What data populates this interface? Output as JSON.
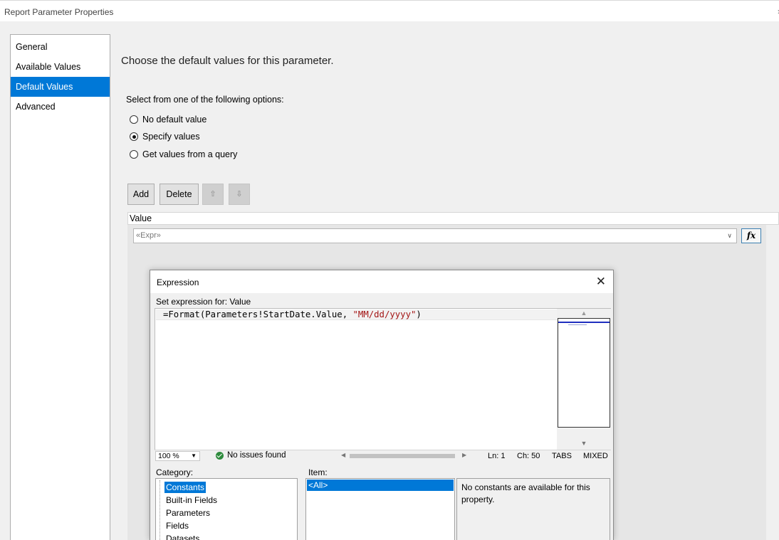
{
  "window": {
    "title": "Report Parameter Properties",
    "close_glyph": "›"
  },
  "nav": {
    "items": [
      {
        "label": "General",
        "selected": false
      },
      {
        "label": "Available Values",
        "selected": false
      },
      {
        "label": "Default Values",
        "selected": true
      },
      {
        "label": "Advanced",
        "selected": false
      }
    ]
  },
  "main": {
    "heading": "Choose the default values for this parameter.",
    "select_label": "Select from one of the following options:",
    "options": [
      {
        "label": "No default value",
        "checked": false
      },
      {
        "label": "Specify values",
        "checked": true
      },
      {
        "label": "Get values from a query",
        "checked": false
      }
    ],
    "buttons": {
      "add": "Add",
      "delete": "Delete",
      "move_up": "⇧",
      "move_down": "⇩"
    },
    "grid": {
      "header": "Value",
      "value_placeholder": "«Expr»",
      "dropdown_glyph": "∨",
      "fx_label": "fx"
    }
  },
  "expression_dialog": {
    "title": "Expression",
    "close_glyph": "✕",
    "set_label": "Set expression for: Value",
    "code_prefix": "=Format(Parameters!StartDate.Value, ",
    "code_string": "\"MM/dd/yyyy\"",
    "code_suffix": ")",
    "status": {
      "zoom": "100 %",
      "issues": "No issues found",
      "line": "Ln: 1",
      "char": "Ch: 50",
      "tabs": "TABS",
      "eol": "MIXED"
    },
    "category_label": "Category:",
    "item_label": "Item:",
    "categories": [
      {
        "label": "Constants",
        "selected": true
      },
      {
        "label": "Built-in Fields",
        "selected": false
      },
      {
        "label": "Parameters",
        "selected": false
      },
      {
        "label": "Fields",
        "selected": false
      },
      {
        "label": "Datasets",
        "selected": false
      }
    ],
    "items": [
      "<All>"
    ],
    "description": "No constants are available for this property."
  },
  "colors": {
    "accent": "#0078d7",
    "string_literal": "#a31515",
    "ok_green": "#2e8b3d"
  }
}
